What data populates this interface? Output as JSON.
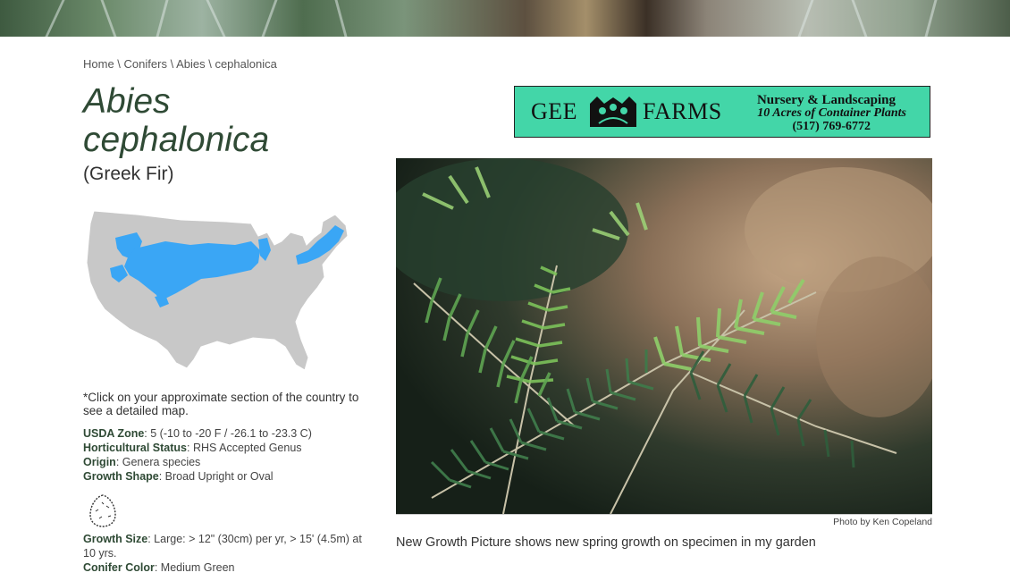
{
  "breadcrumb": {
    "items": [
      "Home",
      "Conifers",
      "Abies",
      "cephalonica"
    ],
    "separator": " \\ "
  },
  "plant": {
    "genus": "Abies",
    "species": "cephalonica",
    "common_name": "(Greek Fir)"
  },
  "map_note": "*Click on your approximate section of the country to see a detailed map.",
  "facts": {
    "usda_zone": {
      "label": "USDA Zone",
      "value": ": 5 (-10 to -20 F / -26.1 to -23.3 C)"
    },
    "horticultural_status": {
      "label": "Horticultural Status",
      "value": ": RHS Accepted Genus"
    },
    "origin": {
      "label": "Origin",
      "value": ": Genera species"
    },
    "growth_shape": {
      "label": "Growth Shape",
      "value": ": Broad Upright or Oval"
    },
    "growth_size": {
      "label": "Growth Size",
      "value": ": Large: > 12\" (30cm) per yr, > 15' (4.5m) at 10 yrs."
    },
    "conifer_color": {
      "label": "Conifer Color",
      "value": ": Medium Green"
    }
  },
  "ad": {
    "brand_left": "GEE",
    "brand_right": "FARMS",
    "line1": "Nursery & Landscaping",
    "line2": "10 Acres of Container Plants",
    "line3": "(517) 769-6772",
    "bg_color": "#43d6a8"
  },
  "photo": {
    "credit": "Photo by Ken Copeland",
    "caption": "New Growth Picture shows new spring growth on specimen in my garden"
  },
  "colors": {
    "title_green": "#2f4a35",
    "map_gray": "#c8c8c8",
    "map_highlight": "#3aa6f5"
  },
  "icons": [
    "us-map-icon",
    "growth-shape-oval-icon",
    "gee-farms-logo-icon"
  ]
}
